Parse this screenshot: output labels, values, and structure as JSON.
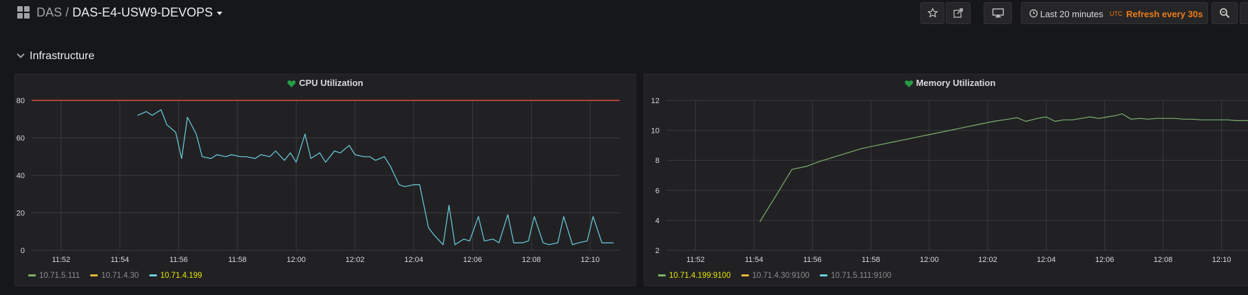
{
  "header": {
    "folder": "DAS",
    "separator": "/",
    "dashboard": "DAS-E4-USW9-DEVOPS",
    "time_range": "Last 20 minutes",
    "timezone": "UTC",
    "refresh": "Refresh every 30s"
  },
  "row": {
    "title": "Infrastructure"
  },
  "colors": {
    "threshold": "#e24d42",
    "green": "#7eb26d",
    "yellow": "#eab839",
    "blue": "#6ed0e0",
    "healthy": "#299c46"
  },
  "chart_data": [
    {
      "type": "line",
      "title": "CPU Utilization",
      "ylim": [
        0,
        80
      ],
      "y_ticks": [
        "0",
        "20",
        "40",
        "60",
        "80"
      ],
      "x_ticks": [
        "11:52",
        "11:54",
        "11:56",
        "11:58",
        "12:00",
        "12:02",
        "12:04",
        "12:06",
        "12:08",
        "12:10"
      ],
      "threshold": 80,
      "legend": [
        {
          "name": "10.71.5.111",
          "color": "#7eb26d",
          "highlight": false
        },
        {
          "name": "10.71.4.30",
          "color": "#eab839",
          "highlight": false
        },
        {
          "name": "10.71.4.199",
          "color": "#6ed0e0",
          "highlight": true
        }
      ],
      "series": [
        {
          "name": "10.71.4.199",
          "color": "#6ed0e0",
          "x": [
            54.6,
            54.9,
            55.1,
            55.4,
            55.6,
            55.9,
            56.1,
            56.3,
            56.6,
            56.8,
            57.1,
            57.3,
            57.6,
            57.8,
            58.1,
            58.3,
            58.6,
            58.8,
            59.1,
            59.3,
            59.6,
            59.8,
            60.0,
            60.3,
            60.5,
            60.8,
            61.0,
            61.3,
            61.5,
            61.8,
            62.0,
            62.3,
            62.5,
            62.7,
            63.0,
            63.2,
            63.5,
            63.7,
            64.0,
            64.2,
            64.5,
            64.7,
            65.0,
            65.2,
            65.4,
            65.7,
            65.9,
            66.2,
            66.4,
            66.7,
            66.9,
            67.2,
            67.4,
            67.7,
            67.9,
            68.1,
            68.4,
            68.6,
            68.9,
            69.1,
            69.4,
            69.6,
            69.9,
            70.1,
            70.4,
            70.6,
            70.8
          ],
          "values": [
            72,
            74,
            72,
            75,
            67,
            63,
            49,
            71,
            62,
            50,
            49,
            51,
            50,
            51,
            50,
            50,
            49,
            51,
            50,
            53,
            48,
            52,
            47,
            62,
            49,
            52,
            47,
            53,
            52,
            56,
            51,
            50,
            50,
            48,
            50,
            45,
            35,
            34,
            35,
            35,
            12,
            8,
            3,
            24,
            3,
            6,
            5,
            18,
            5,
            6,
            4,
            19,
            4,
            4,
            5,
            18,
            4,
            3,
            4,
            18,
            3,
            4,
            5,
            18,
            4,
            4,
            4
          ]
        }
      ]
    },
    {
      "type": "line",
      "title": "Memory Utilization",
      "ylim": [
        2,
        12
      ],
      "y_ticks": [
        "2",
        "4",
        "6",
        "8",
        "10",
        "12"
      ],
      "x_ticks": [
        "11:52",
        "11:54",
        "11:56",
        "11:58",
        "12:00",
        "12:02",
        "12:04",
        "12:06",
        "12:08",
        "12:10"
      ],
      "legend": [
        {
          "name": "10.71.4.199:9100",
          "color": "#7eb26d",
          "highlight": true
        },
        {
          "name": "10.71.4.30:9100",
          "color": "#eab839",
          "highlight": false
        },
        {
          "name": "10.71.5.111:9100",
          "color": "#6ed0e0",
          "highlight": false
        }
      ],
      "series": [
        {
          "name": "10.71.4.199:9100",
          "color": "#7eb26d",
          "x": [
            54.2,
            54.8,
            55.3,
            55.8,
            56.2,
            56.7,
            57.2,
            57.7,
            58.2,
            58.7,
            59.2,
            59.7,
            60.2,
            60.7,
            61.2,
            61.7,
            62.2,
            62.7,
            63.0,
            63.3,
            63.7,
            64.0,
            64.3,
            64.6,
            64.9,
            65.2,
            65.5,
            65.8,
            66.1,
            66.4,
            66.6,
            66.9,
            67.2,
            67.5,
            67.8,
            68.1,
            68.4,
            68.7,
            69.0,
            69.3,
            69.6,
            69.9,
            70.2,
            70.5,
            70.8,
            71.0
          ],
          "values": [
            3.9,
            5.8,
            7.4,
            7.6,
            7.9,
            8.2,
            8.5,
            8.8,
            9.0,
            9.2,
            9.4,
            9.6,
            9.8,
            10.0,
            10.2,
            10.4,
            10.6,
            10.75,
            10.85,
            10.6,
            10.8,
            10.9,
            10.6,
            10.7,
            10.7,
            10.8,
            10.9,
            10.8,
            10.9,
            11.0,
            11.1,
            10.75,
            10.8,
            10.75,
            10.8,
            10.8,
            10.8,
            10.75,
            10.75,
            10.7,
            10.7,
            10.7,
            10.7,
            10.65,
            10.65,
            10.65
          ]
        }
      ]
    }
  ]
}
